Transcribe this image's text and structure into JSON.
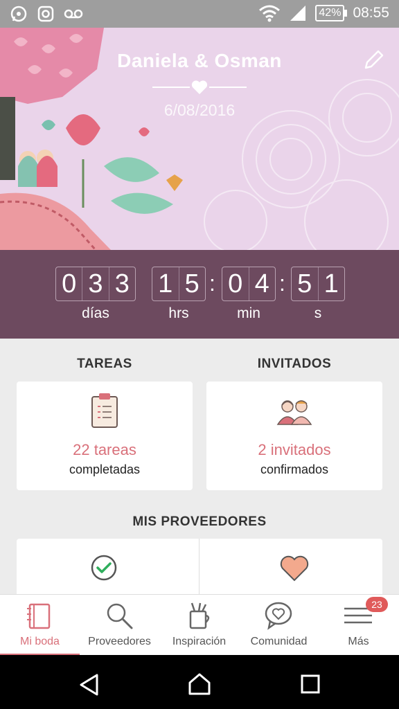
{
  "status_bar": {
    "battery": "42%",
    "time": "08:55"
  },
  "header": {
    "couple": "Daniela & Osman",
    "date": "6/08/2016"
  },
  "countdown": {
    "days": [
      "0",
      "3",
      "3"
    ],
    "hours": [
      "1",
      "5"
    ],
    "minutes": [
      "0",
      "4"
    ],
    "seconds": [
      "5",
      "1"
    ],
    "labels": {
      "days": "días",
      "hours": "hrs",
      "minutes": "min",
      "seconds": "s"
    },
    "separator": ":"
  },
  "sections": {
    "tasks": {
      "title": "TAREAS",
      "count": "22 tareas",
      "subtitle": "completadas"
    },
    "guests": {
      "title": "INVITADOS",
      "count": "2 invitados",
      "subtitle": "confirmados"
    },
    "providers": {
      "title": "MIS PROVEEDORES"
    }
  },
  "tabs": [
    {
      "label": "Mi boda",
      "icon": "notebook-icon"
    },
    {
      "label": "Proveedores",
      "icon": "search-icon"
    },
    {
      "label": "Inspiración",
      "icon": "inspiration-icon"
    },
    {
      "label": "Comunidad",
      "icon": "chat-heart-icon"
    },
    {
      "label": "Más",
      "icon": "menu-icon"
    }
  ],
  "badge": "23",
  "colors": {
    "accent": "#d9707a",
    "countdown_bg": "#6d4a5f",
    "header_bg": "#ead4ea"
  }
}
